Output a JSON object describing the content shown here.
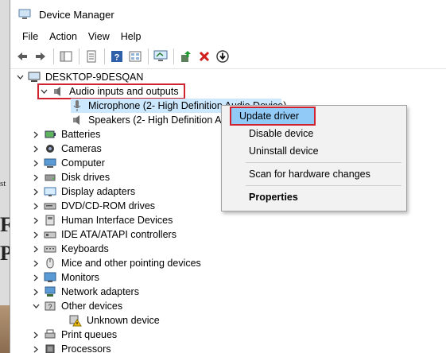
{
  "window": {
    "title": "Device Manager"
  },
  "menu": [
    "File",
    "Action",
    "View",
    "Help"
  ],
  "colors": {
    "selection": "#cce8ff",
    "highlight_outline": "#d0222f",
    "menu_bg": "#f2f2f2"
  },
  "tree": {
    "root": "DESKTOP-9DESQAN",
    "audio": {
      "label": "Audio inputs and outputs",
      "children": [
        "Microphone (2- High Definition Audio Device)",
        "Speakers (2- High Definition Audio Device)"
      ]
    },
    "categories": [
      "Batteries",
      "Cameras",
      "Computer",
      "Disk drives",
      "Display adapters",
      "DVD/CD-ROM drives",
      "Human Interface Devices",
      "IDE ATA/ATAPI controllers",
      "Keyboards",
      "Mice and other pointing devices",
      "Monitors",
      "Network adapters"
    ],
    "other": {
      "label": "Other devices",
      "children": [
        "Unknown device"
      ]
    },
    "tail": [
      "Print queues",
      "Processors"
    ]
  },
  "context_menu": {
    "update": "Update driver",
    "disable": "Disable device",
    "uninstall": "Uninstall device",
    "scan": "Scan for hardware changes",
    "properties": "Properties"
  },
  "page_glyphs": [
    "st",
    "F",
    "P"
  ]
}
